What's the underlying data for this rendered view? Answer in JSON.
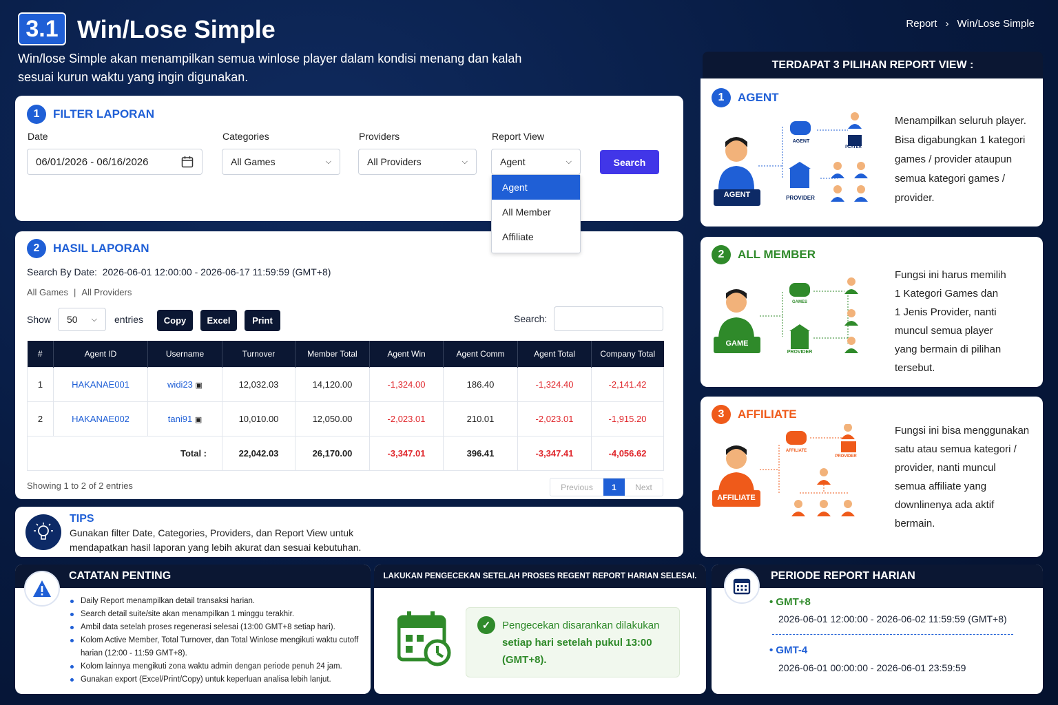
{
  "header": {
    "badge": "3.1",
    "title": "Win/Lose Simple",
    "description": "Win/lose Simple akan menampilkan semua winlose player dalam kondisi menang dan kalah sesuai kurun waktu yang ingin digunakan.",
    "breadcrumb": [
      "Report",
      "Win/Lose Simple"
    ]
  },
  "filter": {
    "num": "1",
    "title": "FILTER LAPORAN",
    "date_label": "Date",
    "date_value": "06/01/2026 - 06/16/2026",
    "categories_label": "Categories",
    "categories_value": "All Games",
    "providers_label": "Providers",
    "providers_value": "All Providers",
    "report_label": "Report View",
    "report_value": "Agent",
    "search_label": "Search",
    "dropdown": [
      "Agent",
      "All Member",
      "Affiliate"
    ]
  },
  "result": {
    "num": "2",
    "title": "HASIL LAPORAN",
    "search_by_date": "Search By Date:  2026-06-01 12:00:00 - 2026-06-17 11:59:59 (GMT+8)",
    "filters_games": "All Games",
    "filters_sep": "|",
    "filters_providers": "All Providers",
    "show_label": "Show",
    "entries_value": "50",
    "entries_label": "entries",
    "copy": "Copy",
    "excel": "Excel",
    "print": "Print",
    "search_label": "Search:",
    "columns": [
      "#",
      "Agent ID",
      "Username",
      "Turnover",
      "Member Total",
      "Agent Win",
      "Agent Comm",
      "Agent Total",
      "Company Total"
    ],
    "rows": [
      [
        "1",
        "HAKANAE001",
        "widi23",
        "12,032.03",
        "14,120.00",
        "-1,324.00",
        "186.40",
        "-1,324.40",
        "-2,141.42"
      ],
      [
        "2",
        "HAKANAE002",
        "tani91",
        "10,010.00",
        "12,050.00",
        "-2,023.01",
        "210.01",
        "-2,023.01",
        "-1,915.20"
      ]
    ],
    "total": [
      "Total :",
      "22,042.03",
      "26,170.00",
      "-3,347.01",
      "396.41",
      "-3,347.41",
      "-4,056.62"
    ],
    "showing": "Showing 1 to 2 of 2 entries",
    "prev": "Previous",
    "page": "1",
    "next": "Next"
  },
  "tips": {
    "title": "TIPS",
    "text1": "Gunakan filter Date, Categories, Providers, dan Report View untuk",
    "text2": "mendapatkan hasil laporan yang lebih akurat dan sesuai kebutuhan."
  },
  "right": {
    "header": "TERDAPAT 3 PILIHAN REPORT VIEW :",
    "agent": {
      "num": "1",
      "title": "AGENT",
      "person": "AGENT",
      "agent_lbl": "AGENT",
      "provider_lbl": "PROVIDER",
      "player_lbl": "PLAYER",
      "lines": [
        "Menampilkan seluruh player.",
        "Bisa digabungkan 1 kategori",
        "games / provider ataupun",
        "semua kategori games /",
        "provider."
      ]
    },
    "member": {
      "num": "2",
      "title": "ALL MEMBER",
      "person": "GAME",
      "games_lbl": "GAMES",
      "provider_lbl": "PROVIDER",
      "lines": [
        "Fungsi ini harus memilih",
        "1 Kategori Games dan",
        "1 Jenis Provider, nanti",
        "muncul semua player",
        "yang bermain di pilihan",
        "tersebut."
      ]
    },
    "affiliate": {
      "num": "3",
      "title": "AFFILIATE",
      "person": "AFFILIATE",
      "aff_lbl": "AFFILIATE",
      "provider_lbl": "PROVIDER",
      "lines": [
        "Fungsi ini bisa menggunakan",
        "satu atau semua kategori /",
        "provider, nanti muncul",
        "semua affiliate yang",
        "downlinenya ada aktif",
        "bermain."
      ]
    }
  },
  "notes": {
    "title": "CATATAN PENTING",
    "items": [
      "Daily Report menampilkan detail transaksi harian.",
      "Search detail suite/site akan menampilkan 1 minggu terakhir.",
      "Ambil data setelah proses regenerasi selesai (13:00 GMT+8 setiap hari).",
      "Kolom Active Member, Total Turnover, dan Total Winlose mengikuti waktu cutoff harian (12:00 - 11:59 GMT+8).",
      "Kolom lainnya mengikuti zona waktu admin dengan periode penuh 24 jam.",
      "Gunakan export (Excel/Print/Copy) untuk keperluan analisa lebih lanjut."
    ]
  },
  "check": {
    "title": "LAKUKAN PENGECEKAN SETELAH PROSES REGENT REPORT HARIAN SELESAI.",
    "line1": "Pengecekan disarankan dilakukan",
    "line2": "setiap hari setelah pukul 13:00",
    "line3": "(GMT+8)."
  },
  "periode": {
    "title": "PERIODE REPORT HARIAN",
    "tz1": "GMT+8",
    "range1": "2026-06-01 12:00:00 - 2026-06-02 11:59:59 (GMT+8)",
    "tz2": "GMT-4",
    "range2": "2026-06-01 00:00:00 - 2026-06-01 23:59:59"
  },
  "colors": {
    "blue": "#1f5fd6",
    "green": "#2f8a2a",
    "orange": "#ef5a1a",
    "navy": "#0b1733",
    "red": "#e0262b"
  }
}
